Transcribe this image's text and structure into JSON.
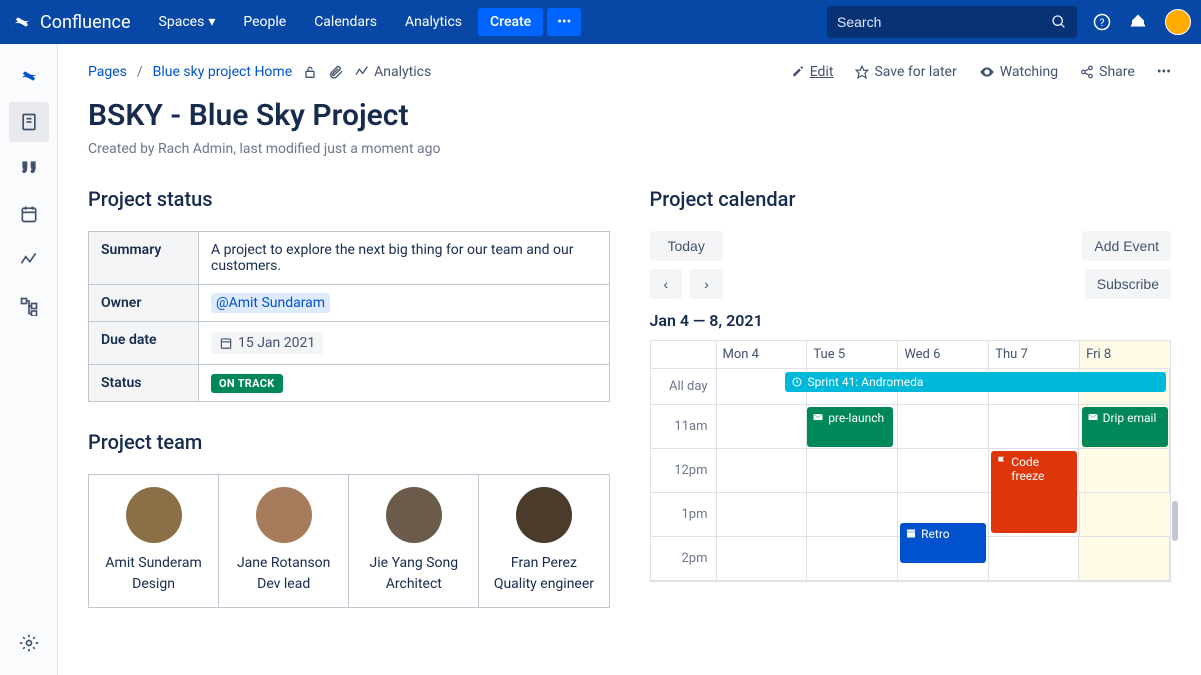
{
  "brand": "Confluence",
  "nav": {
    "spaces": "Spaces",
    "people": "People",
    "calendars": "Calendars",
    "analytics": "Analytics",
    "create": "Create"
  },
  "search_placeholder": "Search",
  "breadcrumb": {
    "pages": "Pages",
    "parent": "Blue sky project Home",
    "analytics": "Analytics"
  },
  "actions": {
    "edit": "Edit",
    "save": "Save for later",
    "watching": "Watching",
    "share": "Share"
  },
  "title": "BSKY - Blue Sky Project",
  "meta": "Created by Rach Admin, last modified just a moment ago",
  "sections": {
    "status": "Project status",
    "team": "Project team",
    "calendar": "Project calendar"
  },
  "status": {
    "summary_label": "Summary",
    "summary": "A project to explore the next big thing for our team and our customers.",
    "owner_label": "Owner",
    "owner": "@Amit Sundaram",
    "due_label": "Due date",
    "due": "15 Jan 2021",
    "status_label": "Status",
    "status_value": "ON TRACK"
  },
  "team": [
    {
      "name": "Amit Sunderam",
      "role": "Design"
    },
    {
      "name": "Jane Rotanson",
      "role": "Dev lead"
    },
    {
      "name": "Jie Yang Song",
      "role": "Architect"
    },
    {
      "name": "Fran Perez",
      "role": "Quality engineer"
    }
  ],
  "calendar": {
    "today": "Today",
    "add_event": "Add Event",
    "subscribe": "Subscribe",
    "range": "Jan 4 — 8, 2021",
    "days": [
      "Mon 4",
      "Tue 5",
      "Wed 6",
      "Thu 7",
      "Fri 8"
    ],
    "allday_label": "All day",
    "allday_event": "Sprint 41: Andromeda",
    "hours": [
      "11am",
      "12pm",
      "1pm",
      "2pm"
    ],
    "events": {
      "prelaunch": "pre-launch",
      "drip": "Drip email",
      "freeze": "Code freeze",
      "retro": "Retro"
    }
  }
}
